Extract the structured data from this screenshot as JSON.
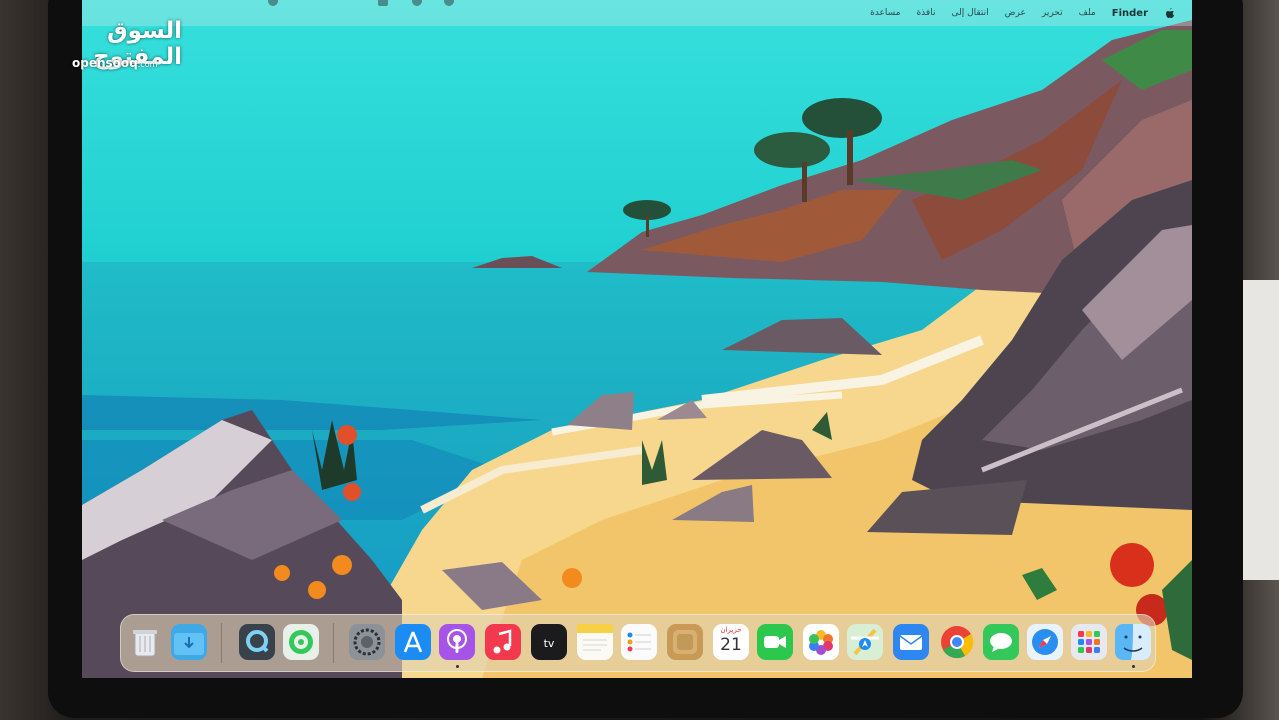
{
  "watermark": {
    "arabic": "السوق المفتوح",
    "site": "opensooq",
    "tld": ".com"
  },
  "menubar": {
    "apple": "apple-icon",
    "app_name": "Finder",
    "items": [
      "ملف",
      "تحرير",
      "عرض",
      "انتقال إلى",
      "نافذة",
      "مساعدة"
    ]
  },
  "dock": {
    "calendar": {
      "month": "حزيران",
      "day": "21"
    },
    "apps": [
      "trash-icon",
      "downloads-folder-icon",
      "quicktime-icon",
      "find-my-icon",
      "system-settings-icon",
      "app-store-icon",
      "podcasts-icon",
      "music-icon",
      "apple-tv-icon",
      "notes-icon",
      "reminders-icon",
      "notes-paper-icon",
      "calendar-icon",
      "facetime-icon",
      "photos-icon",
      "maps-icon",
      "mail-icon",
      "chrome-icon",
      "messages-icon",
      "safari-icon",
      "launchpad-icon",
      "finder-icon"
    ]
  },
  "colors": {
    "sky": "#2fd6d2",
    "sea": "#17a9c4",
    "sand": "#f5cf7c",
    "rock": "#5b4b55"
  }
}
